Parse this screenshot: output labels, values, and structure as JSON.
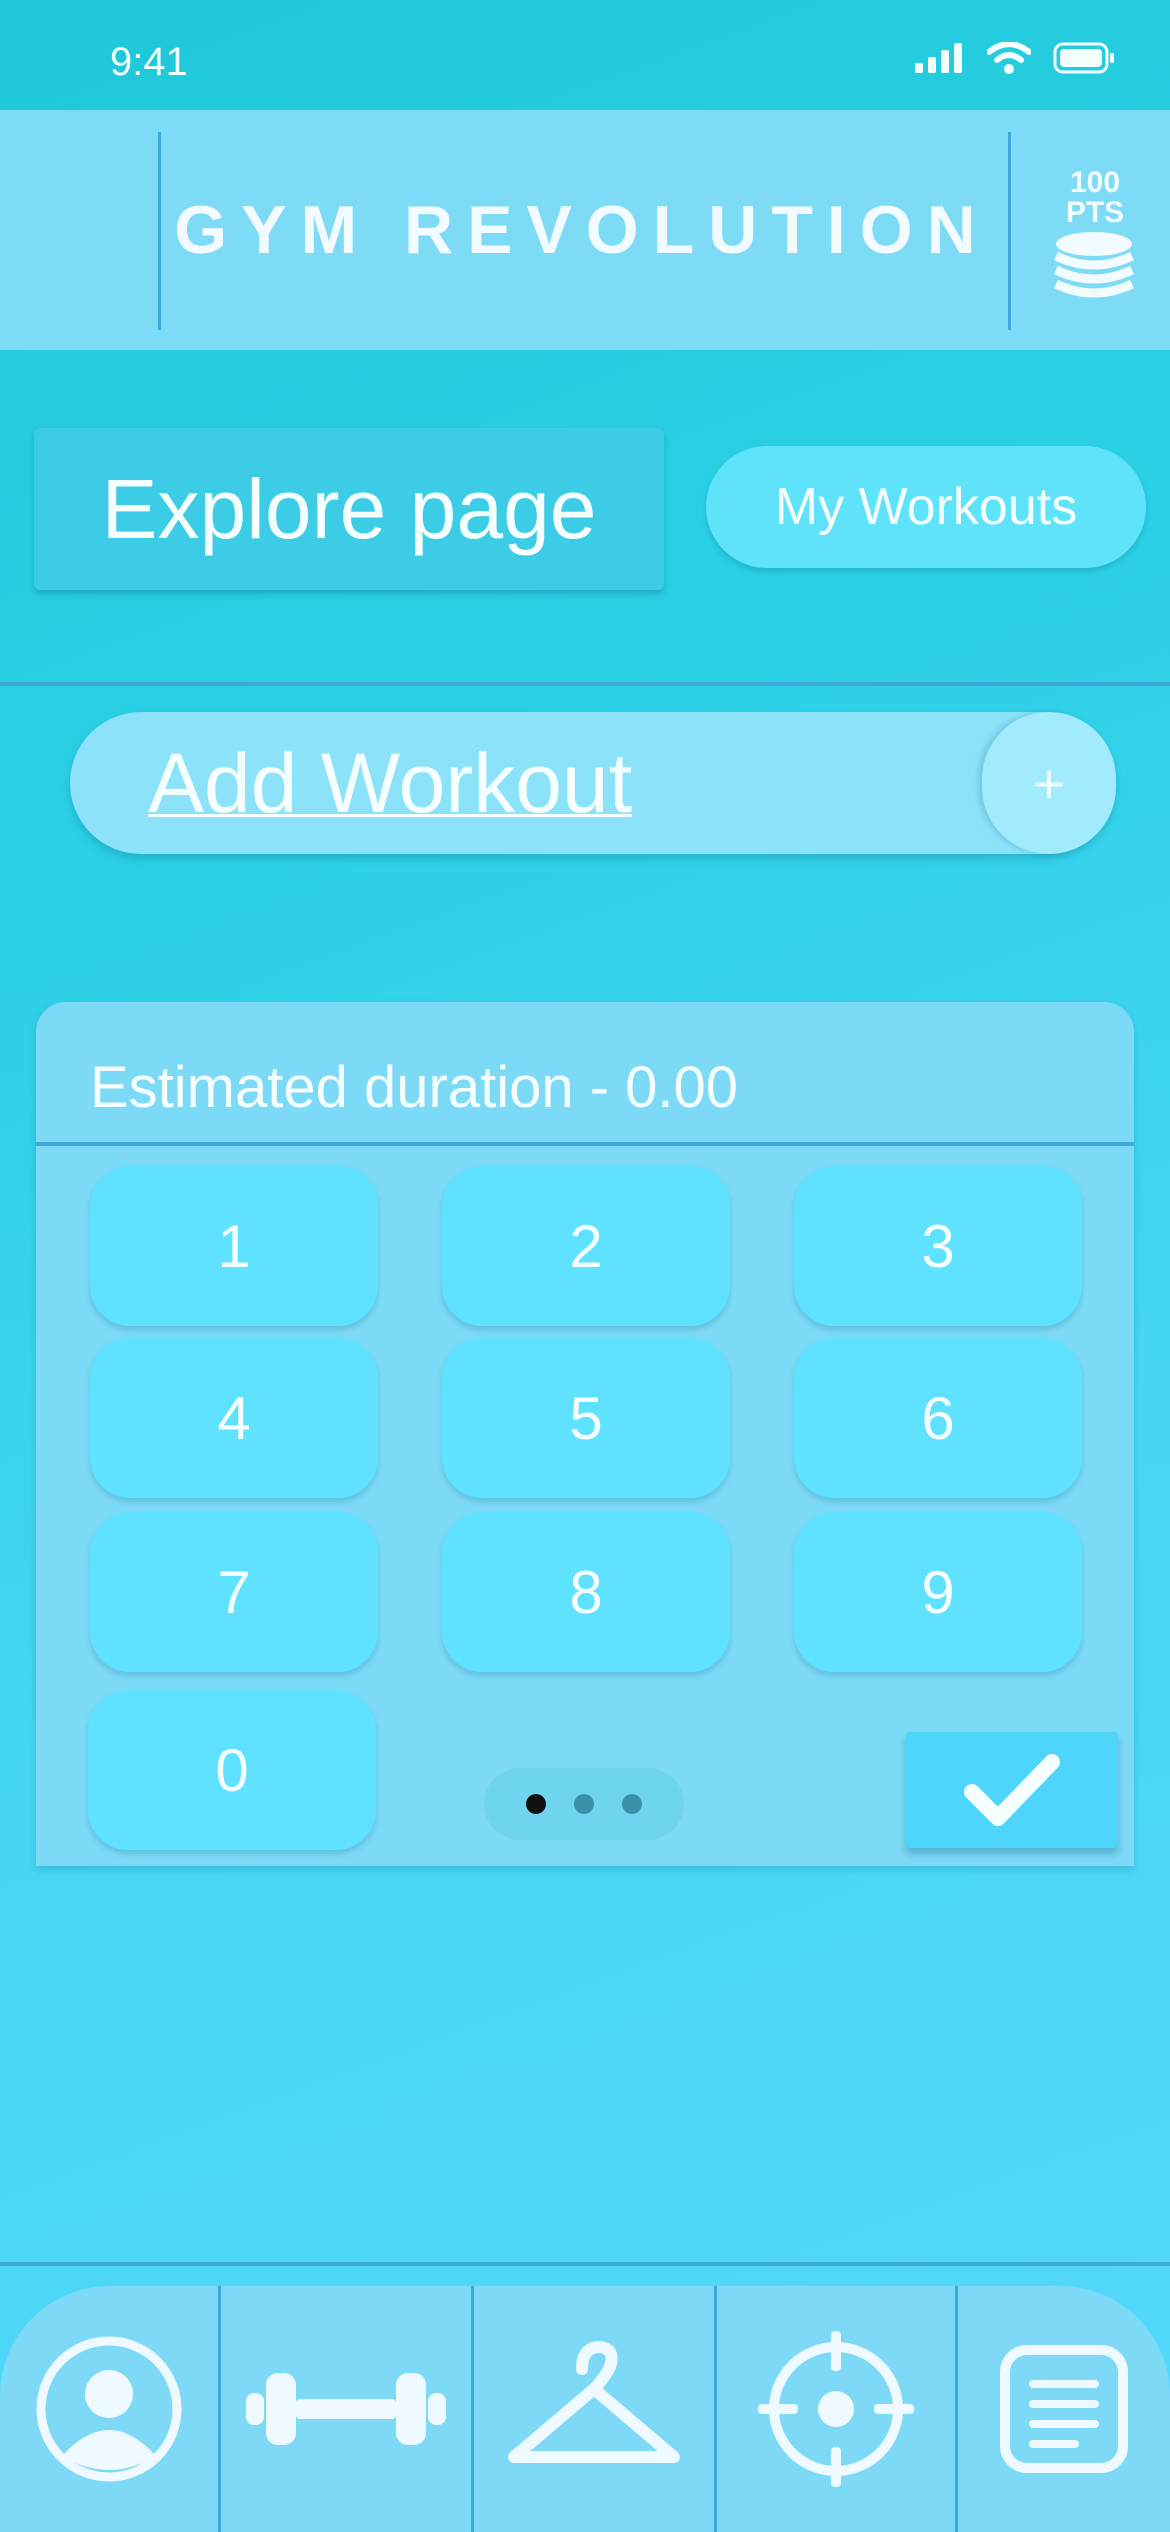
{
  "status_bar": {
    "time": "9:41",
    "icons": [
      "cellular-signal-icon",
      "wifi-icon",
      "battery-icon"
    ]
  },
  "header": {
    "title": "GYM REVOLUTION",
    "points_value": "100",
    "points_unit": "PTS",
    "coins_icon": "coins-stack-icon"
  },
  "tabs": {
    "explore": "Explore page",
    "my_workouts": "My Workouts"
  },
  "add_workout": {
    "label": "Add Workout",
    "plus": "+"
  },
  "keypad": {
    "duration_label": "Estimated duration - 0.00",
    "keys": [
      "1",
      "2",
      "3",
      "4",
      "5",
      "6",
      "7",
      "8",
      "9",
      "0"
    ],
    "pager_dots": 3,
    "active_dot": 1,
    "confirm_icon": "checkmark-icon"
  },
  "bottom_nav": {
    "items": [
      "profile-icon",
      "dumbbell-icon",
      "hanger-icon",
      "target-icon",
      "list-icon"
    ]
  },
  "colors": {
    "background": "#2ad0e4",
    "header": "#7ddbf6",
    "accent_line": "#3fa8d8",
    "key": "#5fe2ff"
  }
}
